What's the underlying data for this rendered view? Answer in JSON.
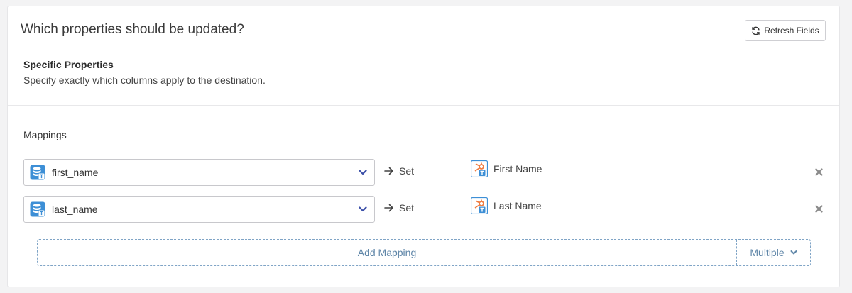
{
  "header": {
    "title": "Which properties should be updated?",
    "refresh_label": "Refresh Fields"
  },
  "specific": {
    "heading": "Specific Properties",
    "description": "Specify exactly which columns apply to the destination."
  },
  "mappings": {
    "label": "Mappings",
    "rows": [
      {
        "source": "first_name",
        "action": "Set",
        "target": "First Name"
      },
      {
        "source": "last_name",
        "action": "Set",
        "target": "Last Name"
      }
    ],
    "add_label": "Add Mapping",
    "multiple_label": "Multiple"
  },
  "colors": {
    "accent": "#5f86a8",
    "chevron": "#3b4fa8",
    "icon_blue": "#3d8fd6"
  },
  "icons": {
    "refresh": "refresh-icon",
    "source": "database-icon",
    "target": "hubspot-property-icon",
    "remove": "close-icon",
    "arrow": "arrow-right-icon",
    "dropdown": "chevron-down-icon"
  }
}
